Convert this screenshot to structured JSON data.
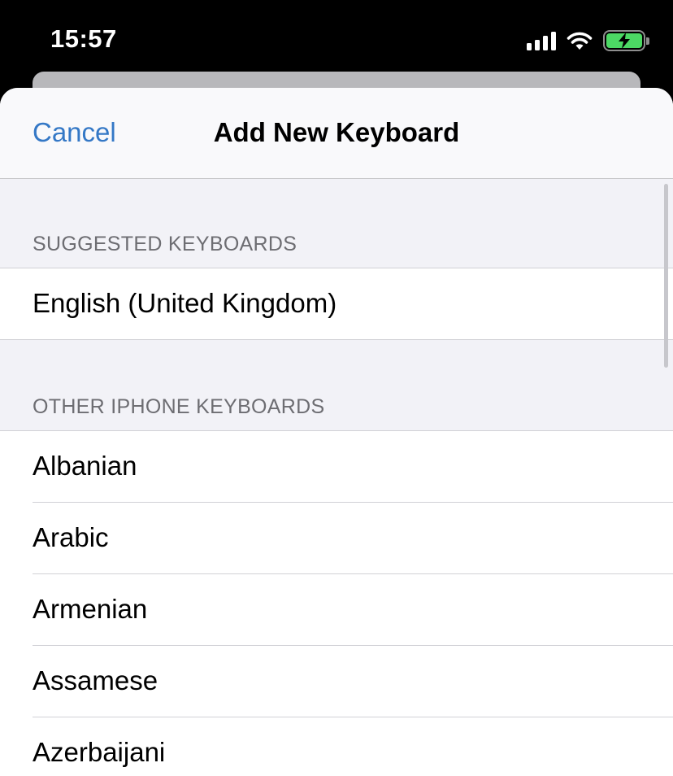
{
  "status_bar": {
    "time": "15:57",
    "icons": [
      "signal-icon",
      "wifi-icon",
      "battery-charging-icon"
    ],
    "battery_color": "#4cd964"
  },
  "navbar": {
    "cancel_label": "Cancel",
    "title": "Add New Keyboard",
    "accent_color": "#3478c6"
  },
  "sections": {
    "suggested": {
      "header": "SUGGESTED KEYBOARDS",
      "items": [
        "English (United Kingdom)"
      ]
    },
    "other": {
      "header": "OTHER IPHONE KEYBOARDS",
      "items": [
        "Albanian",
        "Arabic",
        "Armenian",
        "Assamese",
        "Azerbaijani"
      ]
    }
  }
}
